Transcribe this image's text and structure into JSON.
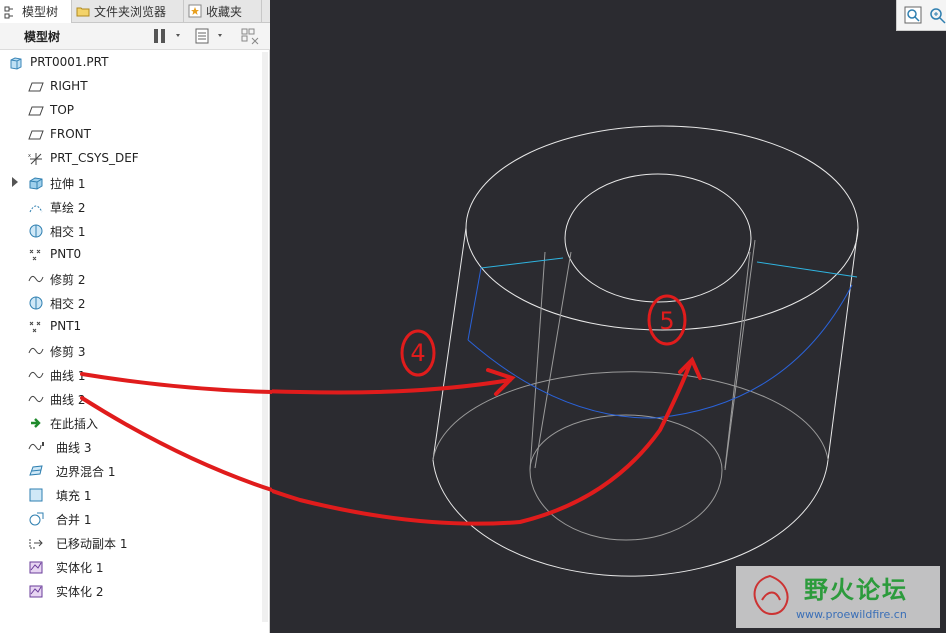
{
  "tabs": [
    {
      "label": "模型树",
      "icon": "tree-icon",
      "active": true
    },
    {
      "label": "文件夹浏览器",
      "icon": "folder-icon",
      "active": false
    },
    {
      "label": "收藏夹",
      "icon": "star-icon",
      "active": false
    }
  ],
  "toolbar": {
    "title": "模型树"
  },
  "tree": {
    "root": "PRT0001.PRT",
    "items": [
      {
        "label": "RIGHT",
        "icon": "datum-plane-icon"
      },
      {
        "label": "TOP",
        "icon": "datum-plane-icon"
      },
      {
        "label": "FRONT",
        "icon": "datum-plane-icon"
      },
      {
        "label": "PRT_CSYS_DEF",
        "icon": "coordinate-system-icon"
      },
      {
        "label": "拉伸 1",
        "icon": "extrude-icon",
        "expandable": true
      },
      {
        "label": "草绘 2",
        "icon": "sketch-icon"
      },
      {
        "label": "相交 1",
        "icon": "intersect-icon"
      },
      {
        "label": "PNT0",
        "icon": "datum-point-icon"
      },
      {
        "label": "修剪 2",
        "icon": "curve-icon"
      },
      {
        "label": "相交 2",
        "icon": "intersect-icon"
      },
      {
        "label": "PNT1",
        "icon": "datum-point-icon"
      },
      {
        "label": "修剪 3",
        "icon": "curve-icon"
      },
      {
        "label": "曲线 1",
        "icon": "curve-icon"
      },
      {
        "label": "曲线 2",
        "icon": "curve-icon"
      },
      {
        "label": "在此插入",
        "icon": "insert-here-icon"
      },
      {
        "label": "曲线 3",
        "icon": "curve-icon"
      },
      {
        "label": "边界混合 1",
        "icon": "boundary-blend-icon"
      },
      {
        "label": "填充 1",
        "icon": "fill-icon"
      },
      {
        "label": "合并 1",
        "icon": "merge-icon"
      },
      {
        "label": "已移动副本 1",
        "icon": "moved-copy-icon"
      },
      {
        "label": "实体化 1",
        "icon": "solidify-icon"
      },
      {
        "label": "实体化 2",
        "icon": "solidify-icon"
      }
    ]
  },
  "annotations": {
    "label_4": "4",
    "label_5": "5"
  },
  "watermark": {
    "title": "野火论坛",
    "url": "www.proewildfire.cn"
  },
  "colors": {
    "viewport_bg": "#2b2b30",
    "edge": "#e8e8e8",
    "highlight": "#2a62d8",
    "datum": "#2fb4e0",
    "annotation": "#e01c1c"
  }
}
